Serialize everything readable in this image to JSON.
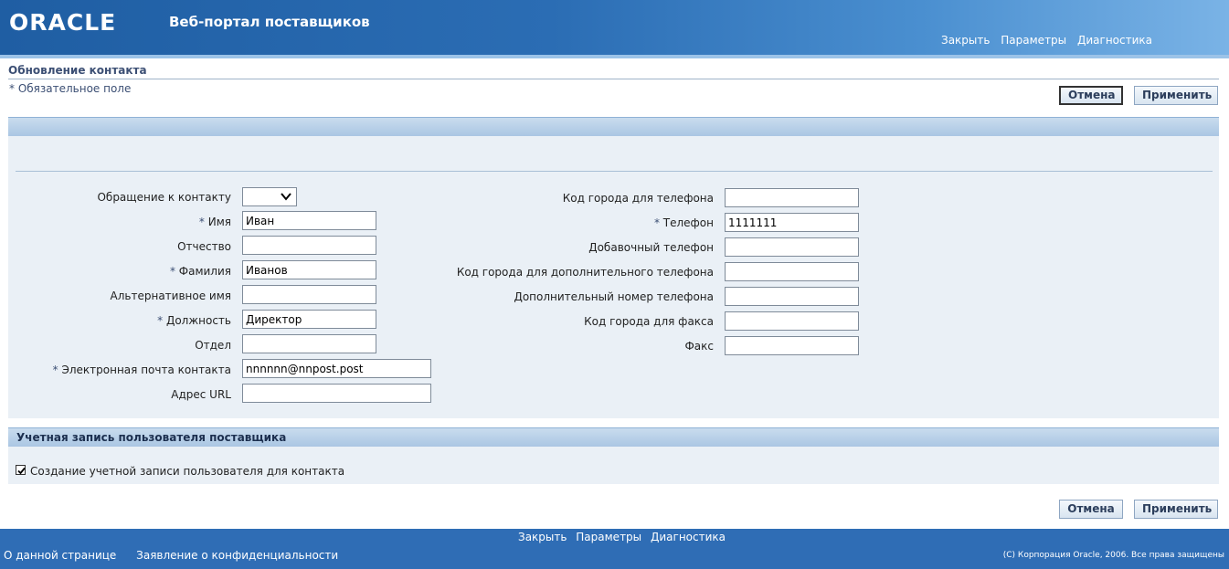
{
  "header": {
    "logo": "ORACLE",
    "app_title": "Веб-портал поставщиков",
    "links": [
      "Закрыть",
      "Параметры",
      "Диагностика"
    ]
  },
  "page": {
    "title": "Обновление контакта",
    "required_note": "*  Обязательное поле",
    "cancel_label": "Отмена",
    "apply_label": "Применить"
  },
  "form": {
    "left": [
      {
        "label": "Обращение к контакту",
        "required": false,
        "value": ""
      },
      {
        "label": "Имя",
        "required": true,
        "value": "Иван"
      },
      {
        "label": "Отчество",
        "required": false,
        "value": ""
      },
      {
        "label": "Фамилия",
        "required": true,
        "value": "Иванов"
      },
      {
        "label": "Альтернативное имя",
        "required": false,
        "value": ""
      },
      {
        "label": "Должность",
        "required": true,
        "value": "Директор"
      },
      {
        "label": "Отдел",
        "required": false,
        "value": ""
      },
      {
        "label": "Электронная почта контакта",
        "required": true,
        "value": "nnnnnn@nnpost.post"
      },
      {
        "label": "Адрес URL",
        "required": false,
        "value": ""
      }
    ],
    "right": [
      {
        "label": "Код города для телефона",
        "required": false,
        "value": ""
      },
      {
        "label": "Телефон",
        "required": true,
        "value": "1111111"
      },
      {
        "label": "Добавочный телефон",
        "required": false,
        "value": ""
      },
      {
        "label": "Код города для дополнительного телефона",
        "required": false,
        "value": ""
      },
      {
        "label": "Дополнительный номер телефона",
        "required": false,
        "value": ""
      },
      {
        "label": "Код города для факса",
        "required": false,
        "value": ""
      },
      {
        "label": "Факс",
        "required": false,
        "value": ""
      }
    ],
    "required_mark": "*"
  },
  "account": {
    "title": "Учетная запись пользователя поставщика",
    "checkbox_label": "Создание учетной записи пользователя для контакта",
    "checkbox_checked": true
  },
  "footer": {
    "links": [
      "Закрыть",
      "Параметры",
      "Диагностика"
    ],
    "about": "О данной странице",
    "privacy": "Заявление о конфиденциальности",
    "copyright": "(C) Корпорация Oracle, 2006. Все права защищены"
  }
}
